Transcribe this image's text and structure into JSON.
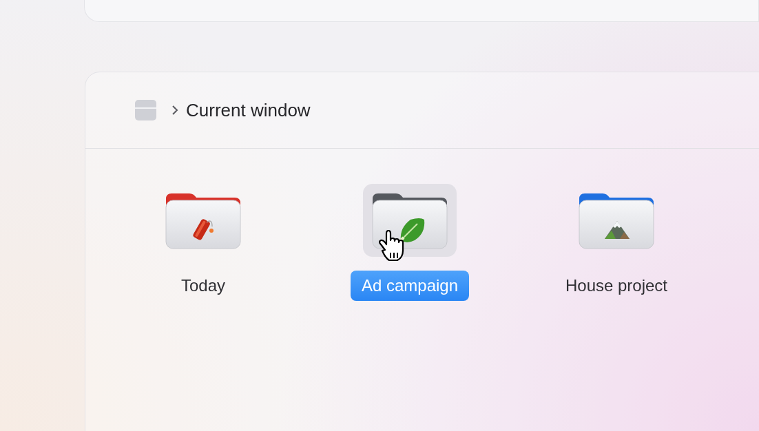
{
  "breadcrumb": {
    "title": "Current window"
  },
  "folders": [
    {
      "label": "Today",
      "color": "#d8322a",
      "selected": false
    },
    {
      "label": "Ad campaign",
      "color": "#55585e",
      "selected": true
    },
    {
      "label": "House project",
      "color": "#1f6fe0",
      "selected": false
    }
  ]
}
